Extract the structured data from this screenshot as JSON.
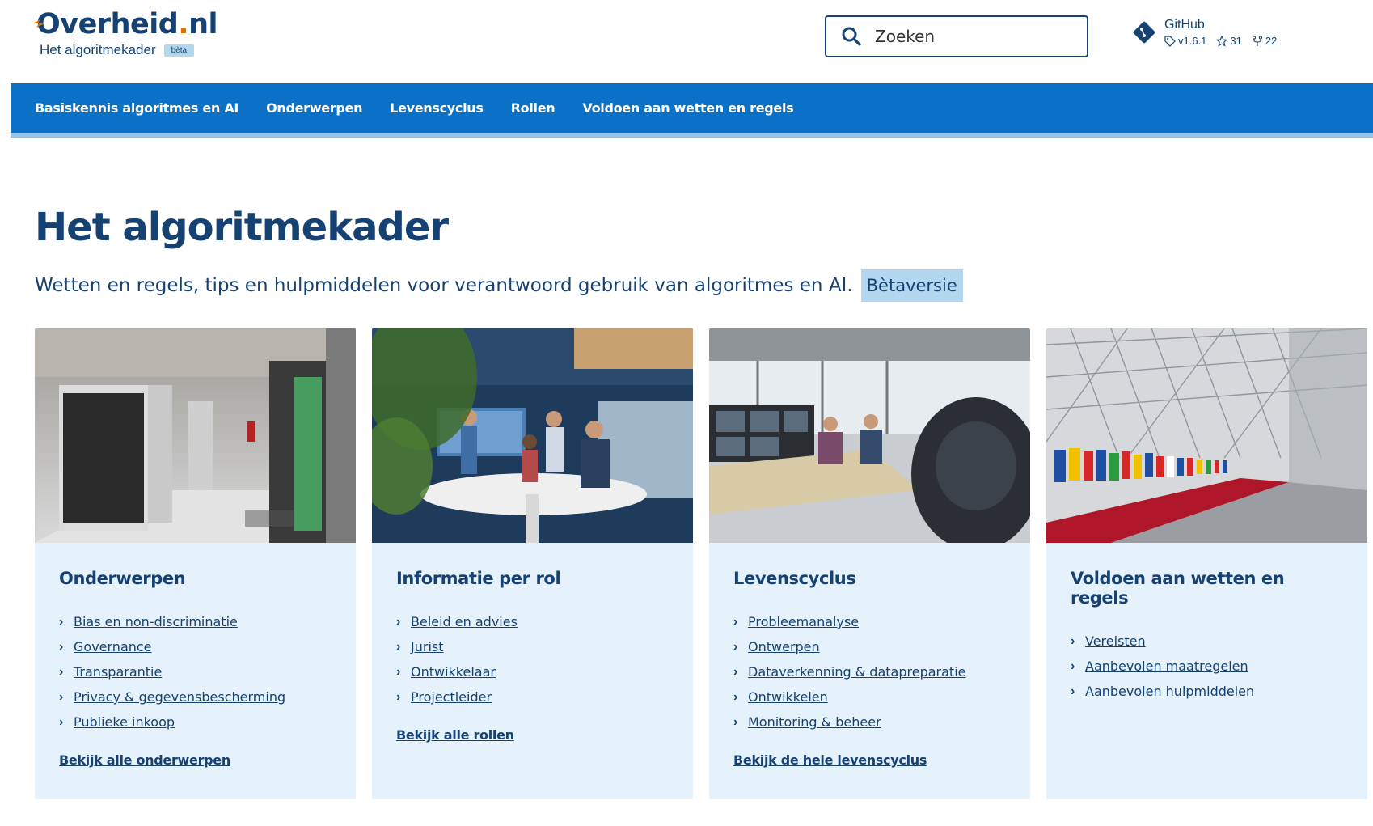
{
  "header": {
    "logo_text_a": "Overheid",
    "logo_text_dot": ".",
    "logo_text_b": "nl",
    "logo_sub": "Het algoritmekader",
    "beta": "bèta",
    "search_placeholder": "Zoeken",
    "github": {
      "name": "GitHub",
      "version": "v1.6.1",
      "stars": "31",
      "forks": "22"
    }
  },
  "nav": {
    "items": [
      "Basiskennis algoritmes en AI",
      "Onderwerpen",
      "Levenscyclus",
      "Rollen",
      "Voldoen aan wetten en regels"
    ]
  },
  "main": {
    "title": "Het algoritmekader",
    "subtitle": "Wetten en regels, tips en hulpmiddelen voor verantwoord gebruik van algoritmes en AI.",
    "subtitle_badge": "Bètaversie"
  },
  "cards": [
    {
      "title": "Onderwerpen",
      "image": "datacenter-photo",
      "items": [
        "Bias en non-discriminatie",
        "Governance",
        "Transparantie",
        "Privacy & gegevensbescherming",
        "Publieke inkoop"
      ],
      "more": "Bekijk alle onderwerpen"
    },
    {
      "title": "Informatie per rol",
      "image": "office-meeting-photo",
      "items": [
        "Beleid en advies",
        "Jurist",
        "Ontwikkelaar",
        "Projectleider"
      ],
      "more": "Bekijk alle rollen"
    },
    {
      "title": "Levenscyclus",
      "image": "control-room-photo",
      "items": [
        "Probleemanalyse",
        "Ontwerpen",
        "Dataverkenning & datapreparatie",
        "Ontwikkelen",
        "Monitoring & beheer"
      ],
      "more": "Bekijk de hele levenscyclus"
    },
    {
      "title": "Voldoen aan wetten en regels",
      "image": "flags-hall-photo",
      "items": [
        "Vereisten",
        "Aanbevolen maatregelen",
        "Aanbevolen hulpmiddelen"
      ],
      "more": ""
    }
  ],
  "colors": {
    "brand": "#154273",
    "nav": "#0b71c7",
    "accent": "#e17000",
    "card_bg": "#e5f1fb"
  }
}
